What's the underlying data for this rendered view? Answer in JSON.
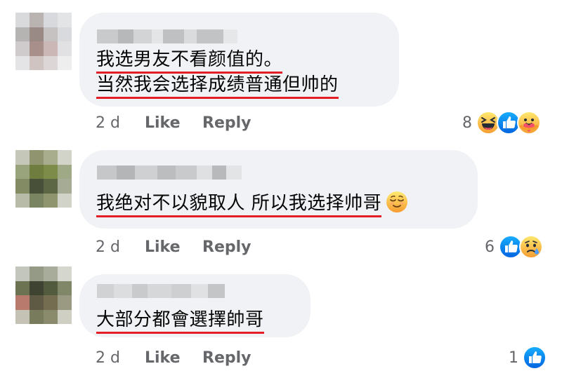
{
  "comments": [
    {
      "lines": [
        "我选男友不看颜值的。",
        "当然我会选择成绩普通但帅的"
      ],
      "time": "2 d",
      "like": "Like",
      "reply": "Reply",
      "reaction_count": "8",
      "reactions": [
        "haha",
        "like",
        "care"
      ]
    },
    {
      "lines": [
        "我绝对不以貌取人 所以我选择帅哥"
      ],
      "inline_emoji": "relieved-face",
      "time": "2 d",
      "like": "Like",
      "reply": "Reply",
      "reaction_count": "6",
      "reactions": [
        "like",
        "sad"
      ]
    },
    {
      "lines": [
        "大部分都會選擇帥哥"
      ],
      "time": "2 d",
      "like": "Like",
      "reply": "Reply",
      "reaction_count": "1",
      "reactions": [
        "like"
      ]
    }
  ],
  "colors": {
    "bubble": "#f0f2f5",
    "meta_text": "#65676b",
    "underline": "#e41e26",
    "like_blue": "#1877f2"
  }
}
